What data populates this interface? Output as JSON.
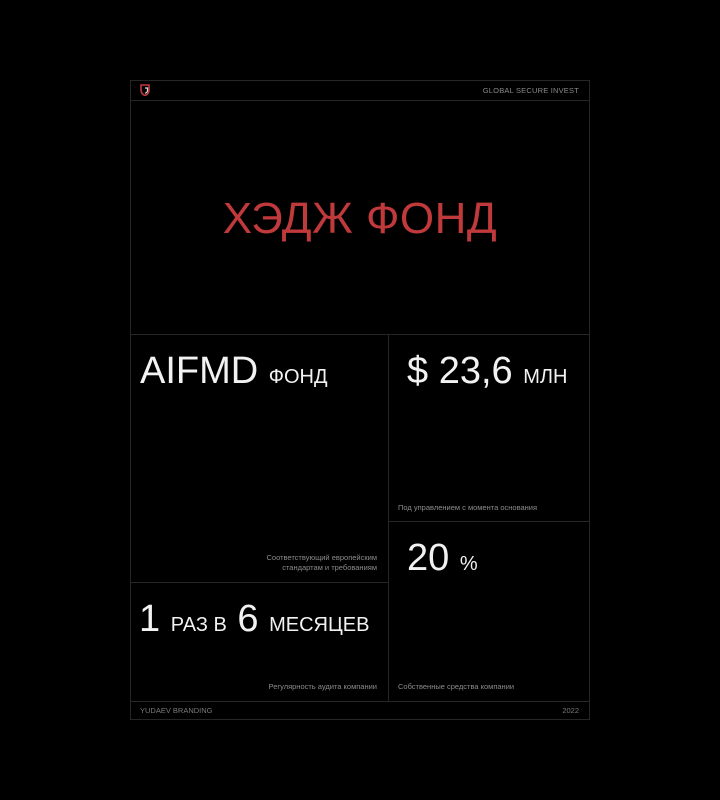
{
  "header": {
    "brand": "GLOBAL SECURE INVEST",
    "logo_icon": "shield-logo-icon"
  },
  "hero": {
    "title": "ХЭДЖ ФОНД"
  },
  "stats": {
    "aifmd": {
      "value": "AIFMD",
      "unit": "ФОНД",
      "caption_line1": "Соответствующий европейским",
      "caption_line2": "стандартам и требованиям"
    },
    "aum": {
      "value": "$ 23,6",
      "unit": "МЛН",
      "caption": "Под управлением  с момента основания"
    },
    "equity": {
      "value": "20",
      "unit": "%",
      "caption": "Собственные средства компании"
    },
    "audit": {
      "value1": "1",
      "unit1": "РАЗ В",
      "value2": "6",
      "unit2": "МЕСЯЦЕВ",
      "caption": "Регулярность аудита компании"
    }
  },
  "footer": {
    "left": "YUDAEV BRANDING",
    "right": "2022"
  },
  "colors": {
    "accent": "#c0393b",
    "background": "#000000",
    "border": "#262626"
  }
}
